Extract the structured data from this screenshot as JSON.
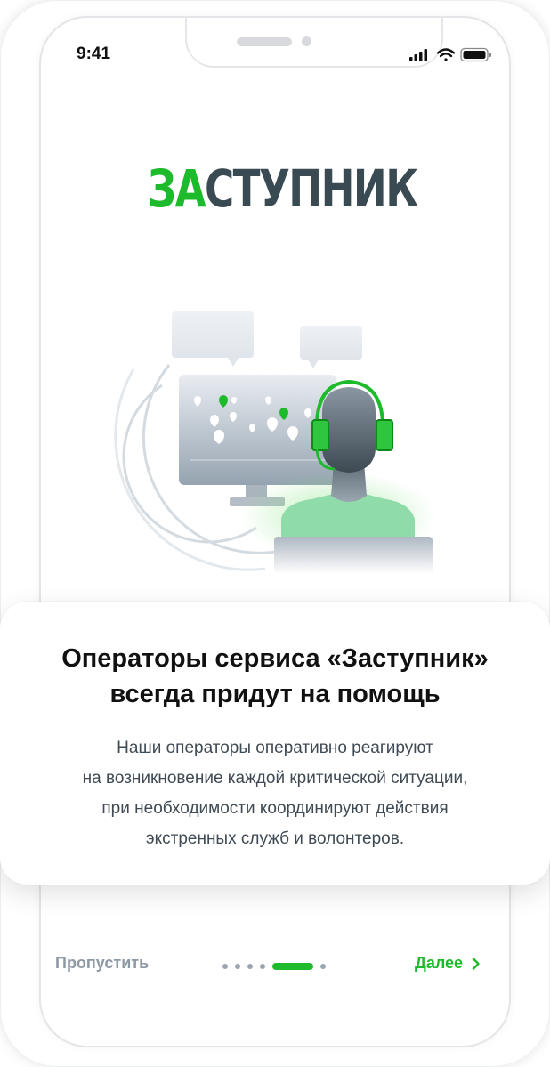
{
  "status_bar": {
    "time": "9:41",
    "icons": [
      "signal-icon",
      "wifi-icon",
      "battery-icon"
    ]
  },
  "logo": {
    "part_green": "ЗА",
    "part_dark": "СТУПНИК"
  },
  "illustration": {
    "description_icon": "operator-headset-illustration"
  },
  "card": {
    "title_lines": [
      "Операторы сервиса «Заступник»",
      "всегда придут на помощь"
    ],
    "description_lines": [
      "Наши операторы оперативно реагируют",
      "на возникновение каждой критической ситуации,",
      "при необходимости координируют действия",
      "экстренных служб и волонтеров."
    ]
  },
  "footer": {
    "skip_label": "Пропустить",
    "next_label": "Далее",
    "pager": {
      "total": 6,
      "active_index": 4
    }
  },
  "colors": {
    "accent": "#1dbb2b",
    "logo_dark": "#3a4a52",
    "text": "#111111",
    "muted": "#8e99a6"
  }
}
